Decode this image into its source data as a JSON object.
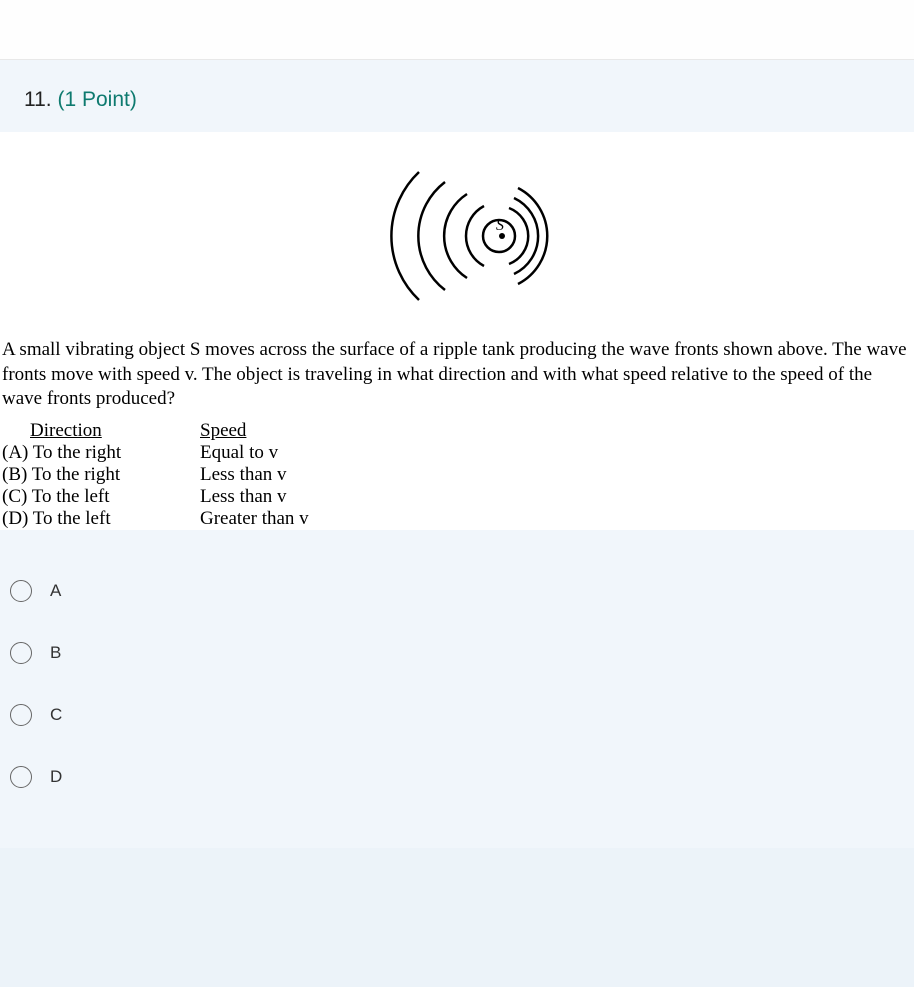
{
  "question": {
    "number": "11.",
    "points": "(1 Point)",
    "text": "A small vibrating object S moves across the surface of a ripple tank producing the wave fronts shown above. The wave fronts move with speed v.  The object is traveling in what direction and with what speed relative to the speed of the wave fronts produced?",
    "headers": {
      "direction": "Direction",
      "speed": "Speed"
    },
    "rows": [
      {
        "label": "(A) To the right",
        "speed": "Equal to v"
      },
      {
        "label": "(B) To the right",
        "speed": "Less than v"
      },
      {
        "label": "(C)  To the left",
        "speed": "Less than v"
      },
      {
        "label": "(D) To the left",
        "speed": "Greater than v"
      }
    ],
    "source_label": "S"
  },
  "options": [
    {
      "label": "A"
    },
    {
      "label": "B"
    },
    {
      "label": "C"
    },
    {
      "label": "D"
    }
  ]
}
